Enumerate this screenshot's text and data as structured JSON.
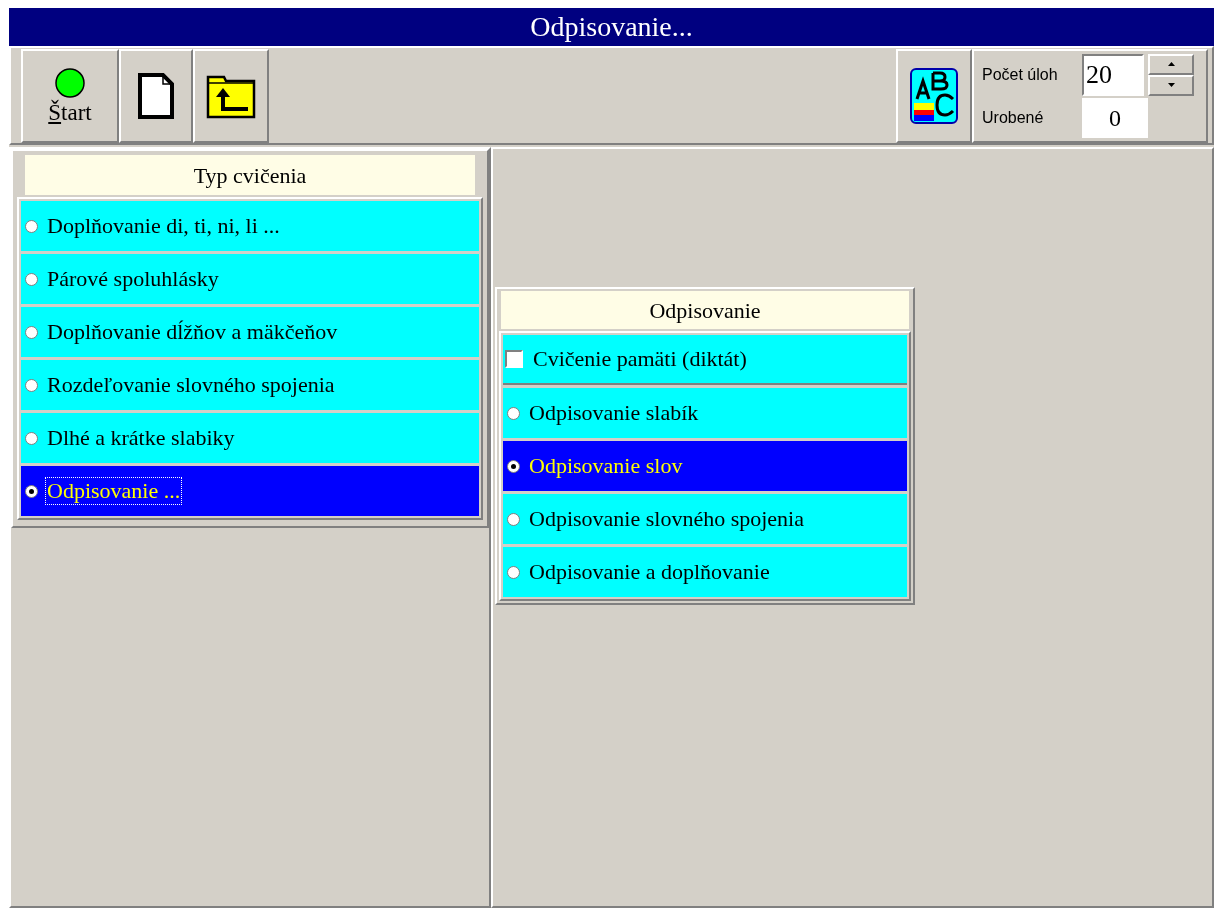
{
  "window": {
    "title": "Odpisovanie..."
  },
  "toolbar": {
    "start_button": {
      "label": "Štart"
    },
    "counter": {
      "task_count": {
        "label": "Počet úloh",
        "value": "20"
      },
      "done": {
        "label": "Urobené",
        "value": "0"
      }
    }
  },
  "exercise_types": {
    "title": "Typ cvičenia",
    "items": [
      {
        "label": "Doplňovanie di, ti, ni, li ...",
        "selected": false,
        "focused": false
      },
      {
        "label": "Párové spoluhlásky",
        "selected": false,
        "focused": false
      },
      {
        "label": "Doplňovanie dĺžňov a mäkčeňov",
        "selected": false,
        "focused": false
      },
      {
        "label": "Rozdeľovanie slovného spojenia",
        "selected": false,
        "focused": false
      },
      {
        "label": "Dlhé a krátke slabiky",
        "selected": false,
        "focused": false
      },
      {
        "label": "Odpisovanie ...",
        "selected": true,
        "focused": true
      }
    ]
  },
  "copying_options": {
    "title": "Odpisovanie",
    "memory_option": {
      "label": "Cvičenie pamäti (diktát)",
      "checked": false
    },
    "items": [
      {
        "label": "Odpisovanie slabík",
        "selected": false
      },
      {
        "label": "Odpisovanie slov",
        "selected": true
      },
      {
        "label": "Odpisovanie slovného spojenia",
        "selected": false
      },
      {
        "label": "Odpisovanie a doplňovanie",
        "selected": false
      }
    ]
  }
}
